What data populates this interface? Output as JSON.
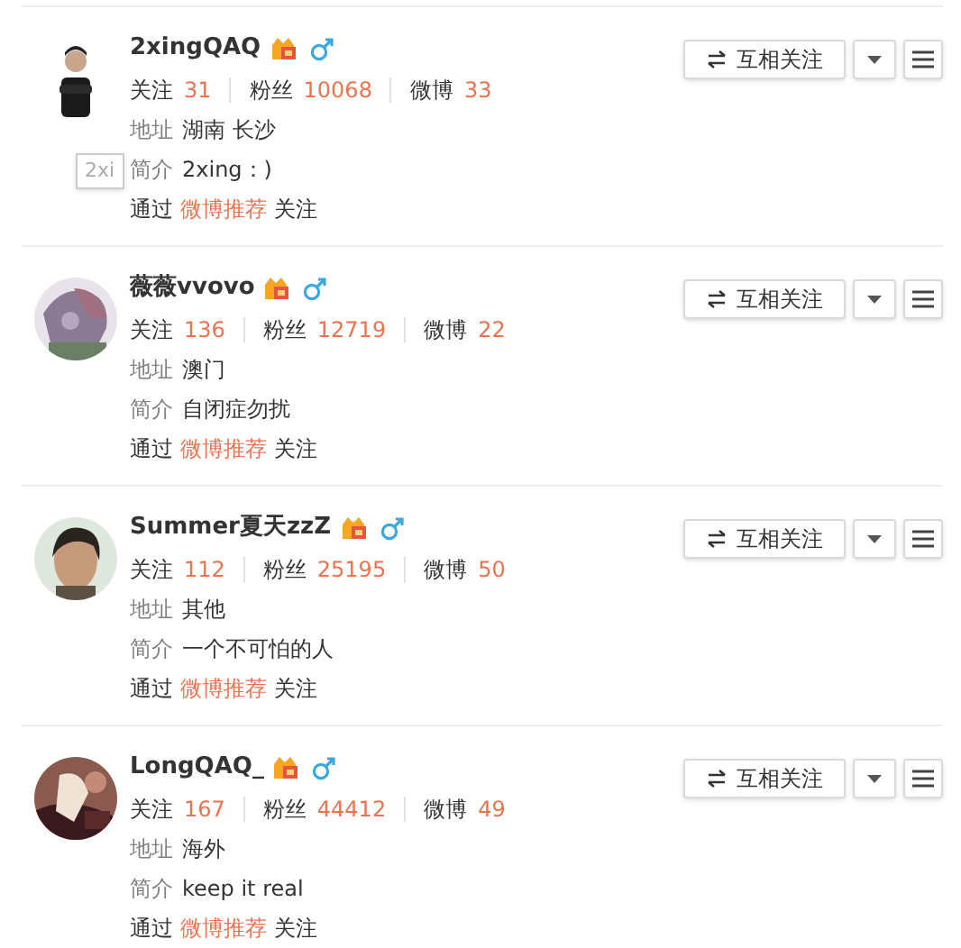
{
  "users": [
    {
      "name": "2xingQAQ",
      "following_label": "关注",
      "following": "31",
      "fans_label": "粉丝",
      "fans": "10068",
      "posts_label": "微博",
      "posts": "33",
      "address_label": "地址",
      "address": "湖南 长沙",
      "bio_label": "简介",
      "bio": "2xing：)",
      "via_prefix": "通过",
      "via_link": "微博推荐",
      "via_suffix": "关注",
      "follow_button": "互相关注",
      "tooltip": "2xi"
    },
    {
      "name": "薇薇vvovo",
      "following_label": "关注",
      "following": "136",
      "fans_label": "粉丝",
      "fans": "12719",
      "posts_label": "微博",
      "posts": "22",
      "address_label": "地址",
      "address": "澳门",
      "bio_label": "简介",
      "bio": "自闭症勿扰",
      "via_prefix": "通过",
      "via_link": "微博推荐",
      "via_suffix": "关注",
      "follow_button": "互相关注"
    },
    {
      "name": "Summer夏天zzZ",
      "following_label": "关注",
      "following": "112",
      "fans_label": "粉丝",
      "fans": "25195",
      "posts_label": "微博",
      "posts": "50",
      "address_label": "地址",
      "address": "其他",
      "bio_label": "简介",
      "bio": "一个不可怕的人",
      "via_prefix": "通过",
      "via_link": "微博推荐",
      "via_suffix": "关注",
      "follow_button": "互相关注"
    },
    {
      "name": "LongQAQ_",
      "following_label": "关注",
      "following": "167",
      "fans_label": "粉丝",
      "fans": "44412",
      "posts_label": "微博",
      "posts": "49",
      "address_label": "地址",
      "address": "海外",
      "bio_label": "简介",
      "bio": "keep it real",
      "via_prefix": "通过",
      "via_link": "微博推荐",
      "via_suffix": "关注",
      "follow_button": "互相关注"
    }
  ]
}
